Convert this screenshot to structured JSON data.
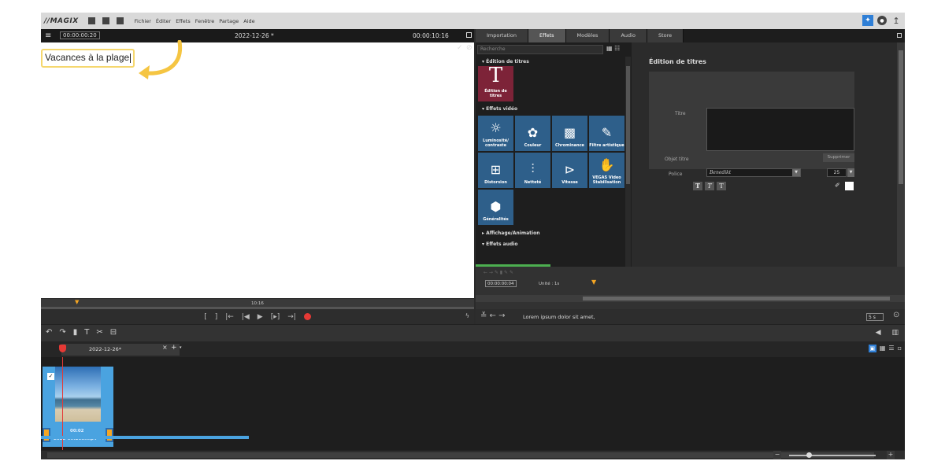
{
  "menubar": {
    "logo": "//MAGIX",
    "items": [
      "Fichier",
      "Éditer",
      "Effets",
      "Fenêtre",
      "Partage",
      "Aide"
    ]
  },
  "preview": {
    "timecode": "00:00:00:20",
    "project_title": "2022-12-26 *",
    "duration": "00:00:10:16",
    "text_overlay": "Vacances à la plage",
    "timeline_mark": "10:16"
  },
  "tabs": [
    "Importation",
    "Effets",
    "Modèles",
    "Audio",
    "Store"
  ],
  "effects": {
    "search_placeholder": "Recherche",
    "sections": {
      "titles": "Édition de titres",
      "video": "Effets vidéo",
      "display": "Affichage/Animation",
      "audio": "Effets audio"
    },
    "title_tile": "Édition de titres",
    "video_tiles": [
      {
        "label": "Luminosité/ contraste",
        "icon": "brightness-icon"
      },
      {
        "label": "Couleur",
        "icon": "palette-icon"
      },
      {
        "label": "Chrominance",
        "icon": "chroma-icon"
      },
      {
        "label": "Filtre artistique",
        "icon": "artistic-filter-icon"
      },
      {
        "label": "Distorsion",
        "icon": "distortion-icon"
      },
      {
        "label": "Netteté",
        "icon": "sharpness-icon"
      },
      {
        "label": "Vitesse",
        "icon": "speed-icon"
      },
      {
        "label": "VEGAS Video Stabilisation",
        "icon": "stabilisation-icon"
      },
      {
        "label": "Généralités",
        "icon": "general-icon"
      }
    ]
  },
  "title_editor": {
    "heading": "Édition de titres",
    "titre_label": "Titre",
    "object_label": "Objet titre",
    "delete_label": "Supprimer",
    "font_label": "Police",
    "font_value": "Benedikt",
    "size_value": "25",
    "styles": [
      "T",
      "T",
      "T"
    ]
  },
  "effect_timeline": {
    "timecode": "00:00:00:04",
    "unit_label": "Unité : 1s"
  },
  "description": {
    "text": "Lorem ipsum dolor sit amet,",
    "duration": "5 s"
  },
  "project_tab": {
    "name": "2022-12-26*"
  },
  "clip": {
    "duration": "00:02",
    "name": "2022-0...205.mp4"
  },
  "colors": {
    "accent_blue": "#2f7fd6",
    "record_red": "#e53935",
    "title_tile": "#7d2338",
    "effect_tile": "#2e5f8a",
    "marker_orange": "#f5a623",
    "highlight_yellow": "#f5d76e"
  }
}
